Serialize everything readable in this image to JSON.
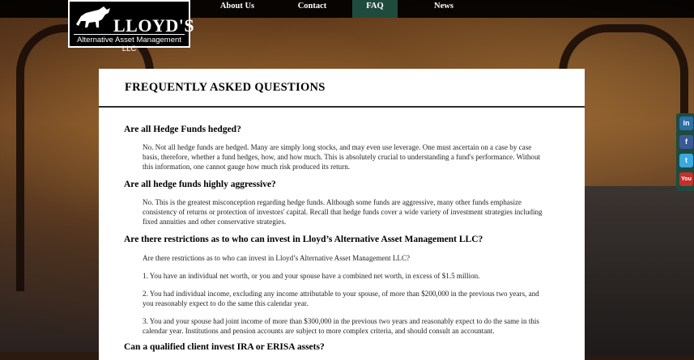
{
  "brand": {
    "name": "LLOYD'S",
    "tagline": "Alternative Asset Management LLC"
  },
  "nav": {
    "items": [
      {
        "label": "About Us",
        "active": false
      },
      {
        "label": "Contact",
        "active": false
      },
      {
        "label": "FAQ",
        "active": true
      },
      {
        "label": "News",
        "active": false
      }
    ]
  },
  "page": {
    "title": "FREQUENTLY ASKED QUESTIONS"
  },
  "faq": [
    {
      "question": "Are all Hedge Funds hedged?",
      "answer": [
        "No. Not all hedge funds are hedged. Many are simply long stocks, and may even use leverage. One must ascertain on a case by case basis, therefore, whether a fund hedges, how, and how much. This is absolutely crucial to understanding a fund's performance. Without this information, one cannot gauge how much risk produced its return."
      ]
    },
    {
      "question": "Are all hedge funds highly aggressive?",
      "answer": [
        "No. This is the greatest misconception regarding hedge funds. Although some funds are aggressive, many other funds emphasize consistency of returns or protection of investors' capital. Recall that hedge funds cover a wide variety of investment strategies including fixed annuities and other conservative strategies."
      ]
    },
    {
      "question": "Are there restrictions as to who can invest in Lloyd’s Alternative Asset Management LLC?",
      "answer": [
        "Are there restrictions as to who can invest in Lloyd’s Alternative Asset Management LLC?",
        "1. You have an individual net worth, or you and your spouse have a combined net worth, in excess of $1.5 million.",
        "2. You had individual income, excluding any income attributable to your spouse, of more than $200,000 in the previous two years, and you reasonably expect to do the same this calendar year.",
        "3. You and your spouse had joint income of more than $300,000 in the previous two years and reasonably expect to do the same in this calendar year. Institutions and pension accounts are subject to more complex criteria, and should consult an accountant."
      ]
    },
    {
      "question": "Can a qualified client invest IRA or ERISA assets?",
      "answer": []
    }
  ],
  "social": [
    {
      "icon": "linkedin-icon",
      "label": "in",
      "color": "#2a6fa8"
    },
    {
      "icon": "facebook-icon",
      "label": "f",
      "color": "#3b5998"
    },
    {
      "icon": "twitter-icon",
      "label": "t",
      "color": "#39a9e0"
    },
    {
      "icon": "youtube-icon",
      "label": "You",
      "color": "#c4302b"
    }
  ]
}
